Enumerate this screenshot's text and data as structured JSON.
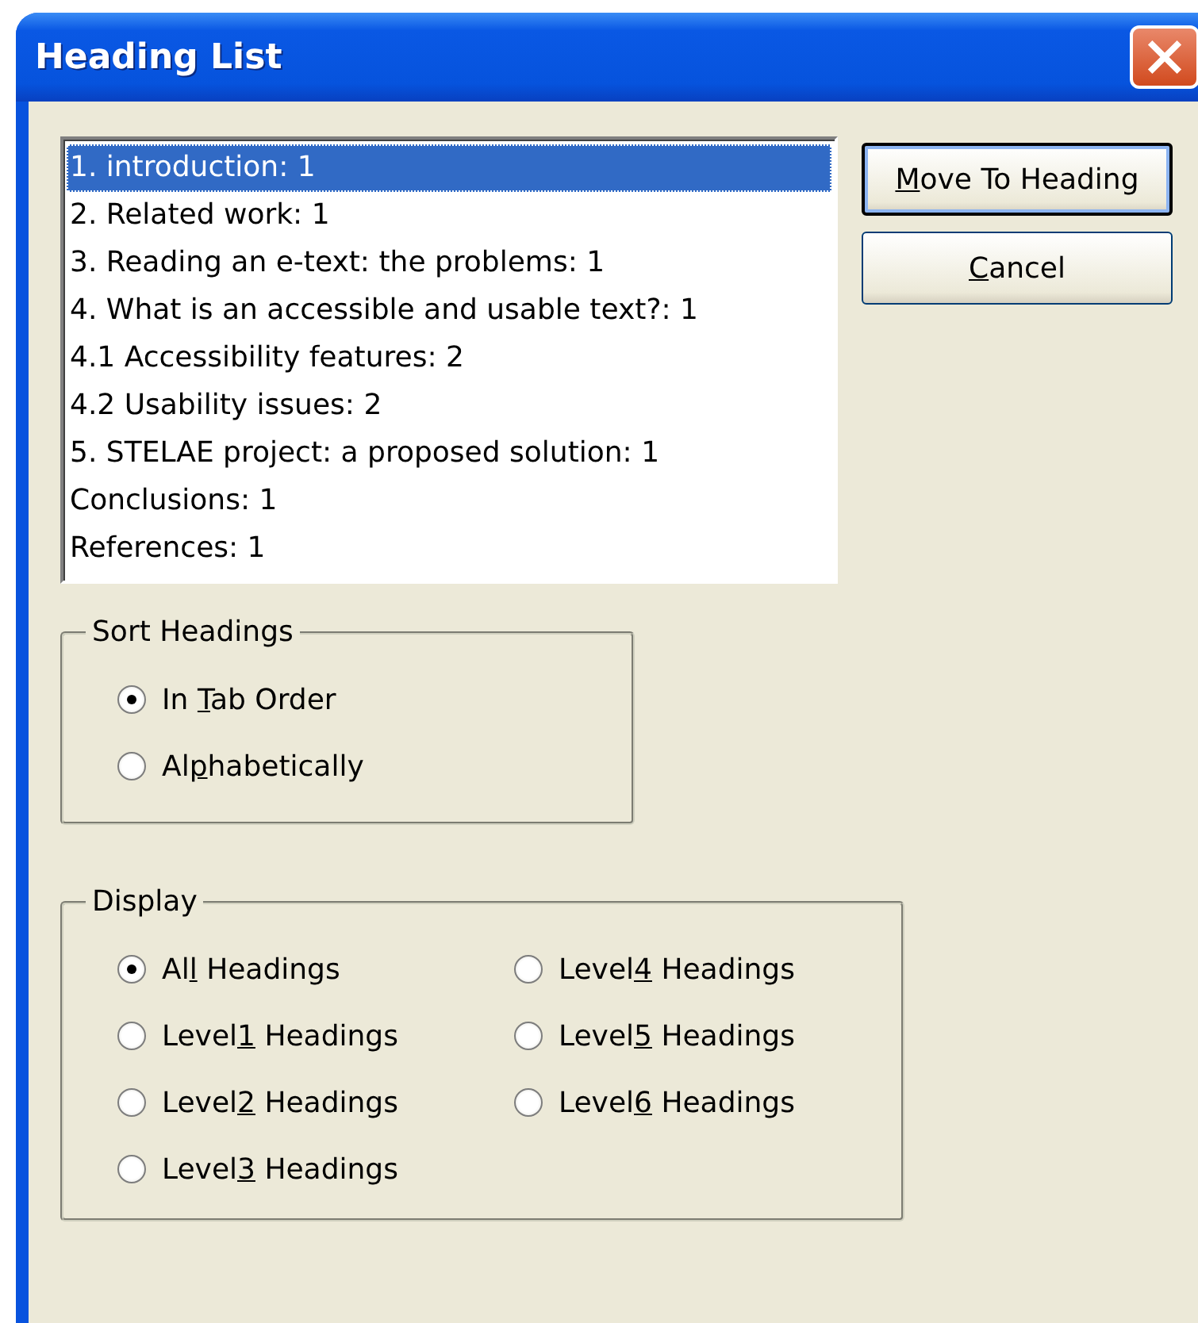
{
  "window": {
    "title": "Heading List"
  },
  "headings": [
    {
      "text": "1. introduction: 1",
      "selected": true
    },
    {
      "text": "2. Related work: 1",
      "selected": false
    },
    {
      "text": "3. Reading an e-text: the problems: 1",
      "selected": false
    },
    {
      "text": "4. What is an accessible and usable text?: 1",
      "selected": false
    },
    {
      "text": "4.1 Accessibility features: 2",
      "selected": false
    },
    {
      "text": "4.2 Usability issues: 2",
      "selected": false
    },
    {
      "text": "5. STELAE project: a proposed solution: 1",
      "selected": false
    },
    {
      "text": "Conclusions: 1",
      "selected": false
    },
    {
      "text": "References: 1",
      "selected": false
    }
  ],
  "buttons": [
    {
      "access_key": "M",
      "label_end": "ove To Heading",
      "default": true
    },
    {
      "access_key": "C",
      "label_end": "ancel",
      "default": false
    }
  ],
  "sort_headings": {
    "title": "Sort Headings",
    "options": [
      {
        "label_start": "In ",
        "access_key": "T",
        "label_end": "ab Order",
        "selected": true
      },
      {
        "label_start": "Al",
        "access_key": "p",
        "label_end": "habetically",
        "selected": false
      }
    ]
  },
  "display": {
    "title": "Display",
    "options": [
      {
        "label_start": "Al",
        "access_key": "l",
        "label_end": " Headings",
        "selected": true
      },
      {
        "label_start": "Level",
        "access_key": "1",
        "label_end": " Headings",
        "selected": false
      },
      {
        "label_start": "Level",
        "access_key": "2",
        "label_end": " Headings",
        "selected": false
      },
      {
        "label_start": "Level",
        "access_key": "3",
        "label_end": " Headings",
        "selected": false
      },
      {
        "label_start": "Level",
        "access_key": "4",
        "label_end": " Headings",
        "selected": false
      },
      {
        "label_start": "Level",
        "access_key": "5",
        "label_end": " Headings",
        "selected": false
      },
      {
        "label_start": "Level",
        "access_key": "6",
        "label_end": " Headings",
        "selected": false
      }
    ]
  }
}
